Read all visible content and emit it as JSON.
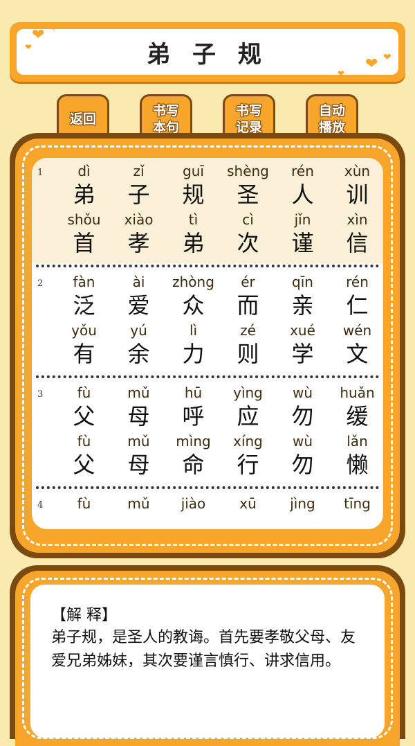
{
  "header": {
    "title": "弟 子 规"
  },
  "toolbar": {
    "back_label": "返回",
    "write_sentence_label": "书写\n本句",
    "write_record_label": "书写\n记录",
    "autoplay_label": "自动\n播放"
  },
  "verses": [
    {
      "number": "1",
      "lines": [
        [
          [
            "dì",
            "弟"
          ],
          [
            "zǐ",
            "子"
          ],
          [
            "guī",
            "规"
          ],
          [
            "shèng",
            "圣"
          ],
          [
            "rén",
            "人"
          ],
          [
            "xùn",
            "训"
          ]
        ],
        [
          [
            "shǒu",
            "首"
          ],
          [
            "xiào",
            "孝"
          ],
          [
            "tì",
            "弟"
          ],
          [
            "cì",
            "次"
          ],
          [
            "jǐn",
            "谨"
          ],
          [
            "xìn",
            "信"
          ]
        ]
      ]
    },
    {
      "number": "2",
      "lines": [
        [
          [
            "fàn",
            "泛"
          ],
          [
            "ài",
            "爱"
          ],
          [
            "zhòng",
            "众"
          ],
          [
            "ér",
            "而"
          ],
          [
            "qīn",
            "亲"
          ],
          [
            "rén",
            "仁"
          ]
        ],
        [
          [
            "yǒu",
            "有"
          ],
          [
            "yú",
            "余"
          ],
          [
            "lì",
            "力"
          ],
          [
            "zé",
            "则"
          ],
          [
            "xué",
            "学"
          ],
          [
            "wén",
            "文"
          ]
        ]
      ]
    },
    {
      "number": "3",
      "lines": [
        [
          [
            "fù",
            "父"
          ],
          [
            "mǔ",
            "母"
          ],
          [
            "hū",
            "呼"
          ],
          [
            "yìng",
            "应"
          ],
          [
            "wù",
            "勿"
          ],
          [
            "huǎn",
            "缓"
          ]
        ],
        [
          [
            "fù",
            "父"
          ],
          [
            "mǔ",
            "母"
          ],
          [
            "mìng",
            "命"
          ],
          [
            "xíng",
            "行"
          ],
          [
            "wù",
            "勿"
          ],
          [
            "lǎn",
            "懒"
          ]
        ]
      ]
    },
    {
      "number": "4",
      "lines": [
        [
          [
            "fù",
            ""
          ],
          [
            "mǔ",
            ""
          ],
          [
            "jiào",
            ""
          ],
          [
            "xū",
            ""
          ],
          [
            "jìng",
            ""
          ],
          [
            "tīng",
            ""
          ]
        ]
      ]
    }
  ],
  "explanation": {
    "heading": "【解 释】",
    "body": "弟子规，是圣人的教诲。首先要孝敬父母、友爱兄弟姊妹，其次要谨言慎行、讲求信用。"
  },
  "colors": {
    "accent": "#f7a52b",
    "border": "#7a4a10",
    "background": "#fbeab0"
  }
}
